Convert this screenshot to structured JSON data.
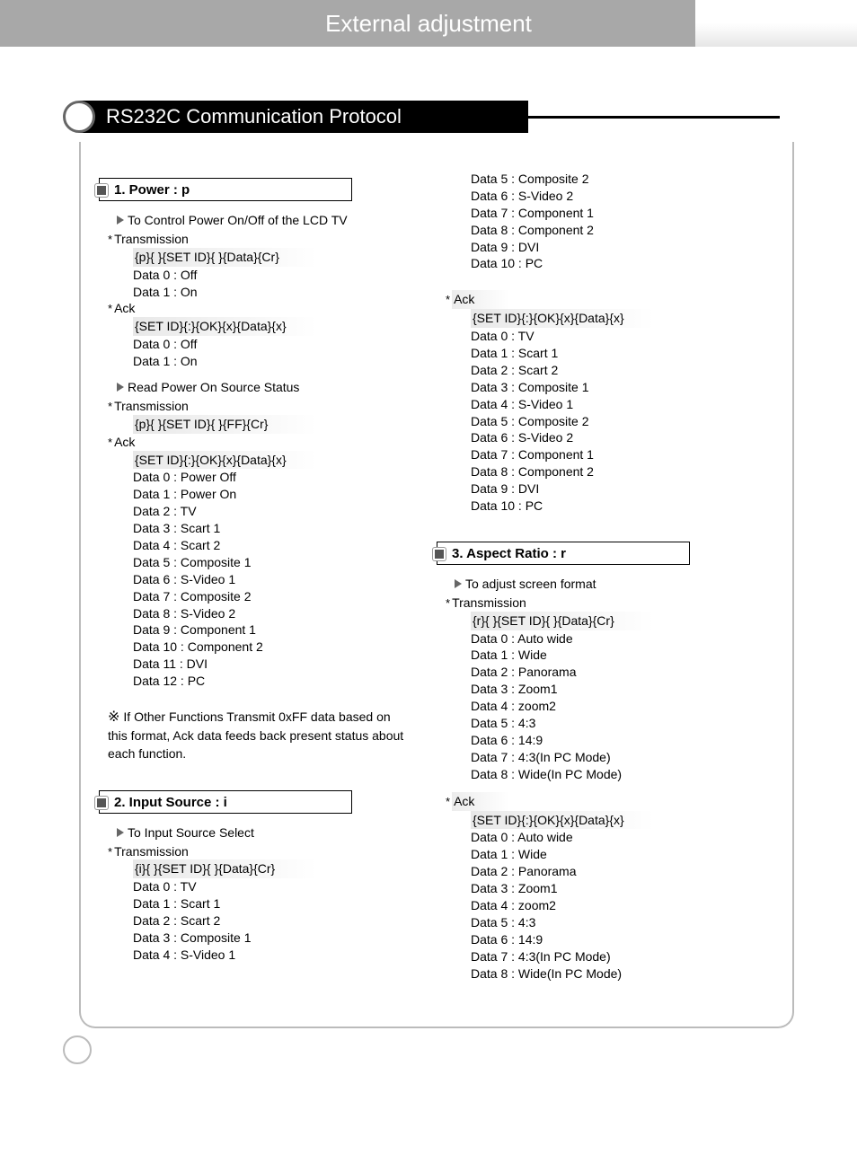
{
  "header": {
    "title": "External adjustment"
  },
  "section": {
    "title": "RS232C Communication Protocol"
  },
  "col1": {
    "cmd1": {
      "header": "1. Power : p",
      "desc1": "To Control Power On/Off of the LCD TV",
      "trans_label": "Transmission",
      "trans_code": "{p}{ }{SET ID}{ }{Data}{Cr}",
      "trans_data": [
        "Data 0 : Off",
        "Data 1 : On"
      ],
      "ack_label": "Ack",
      "ack_code": "{SET ID}{:}{OK}{x}{Data}{x}",
      "ack_data": [
        "Data 0 : Off",
        "Data 1 : On"
      ],
      "desc2": "Read Power On Source Status",
      "trans2_label": "Transmission",
      "trans2_code": "{p}{ }{SET ID}{ }{FF}{Cr}",
      "ack2_label": "Ack",
      "ack2_code": "{SET ID}{:}{OK}{x}{Data}{x}",
      "ack2_data": [
        "Data 0 : Power Off",
        "Data 1 : Power On",
        "Data 2 : TV",
        "Data 3 : Scart 1",
        "Data 4 : Scart 2",
        "Data 5 : Composite 1",
        "Data 6 : S-Video 1",
        "Data 7 : Composite 2",
        "Data 8 : S-Video 2",
        "Data 9 : Component 1",
        "Data 10 : Component 2",
        "Data 11 : DVI",
        "Data 12 : PC"
      ],
      "footnote": "If Other Functions Transmit 0xFF data based on this format, Ack data feeds back present status about each function."
    },
    "cmd2": {
      "header": "2. Input Source : i",
      "desc": "To Input Source Select",
      "trans_label": "Transmission",
      "trans_code": "{i}{ }{SET ID}{ }{Data}{Cr}",
      "trans_data_part1": [
        "Data 0 : TV",
        "Data 1 : Scart 1",
        "Data 2 : Scart 2",
        "Data 3 : Composite 1",
        "Data 4 : S-Video 1"
      ]
    }
  },
  "col2": {
    "cmd2_cont": {
      "trans_data_part2": [
        "Data 5 : Composite 2",
        "Data 6 : S-Video 2",
        "Data 7 : Component 1",
        "Data 8 : Component 2",
        "Data 9 : DVI",
        "Data 10 : PC"
      ],
      "ack_label": "Ack",
      "ack_code": "{SET ID}{:}{OK}{x}{Data}{x}",
      "ack_data": [
        "Data 0 : TV",
        "Data 1 : Scart 1",
        "Data 2 : Scart 2",
        "Data 3 : Composite 1",
        "Data 4 : S-Video 1",
        "Data 5 : Composite 2",
        "Data 6 : S-Video 2",
        "Data 7 : Component 1",
        "Data 8 : Component 2",
        "Data 9 : DVI",
        "Data 10 : PC"
      ]
    },
    "cmd3": {
      "header": "3. Aspect Ratio : r",
      "desc": "To adjust screen format",
      "trans_label": "Transmission",
      "trans_code": "{r}{ }{SET ID}{ }{Data}{Cr}",
      "trans_data": [
        "Data 0 : Auto wide",
        "Data 1 : Wide",
        "Data 2 : Panorama",
        "Data 3 : Zoom1",
        "Data 4 : zoom2",
        "Data 5 : 4:3",
        "Data 6 : 14:9",
        "Data 7 : 4:3(In PC Mode)",
        "Data 8 : Wide(In PC Mode)"
      ],
      "ack_label": "Ack",
      "ack_code": "{SET ID}{:}{OK}{x}{Data}{x}",
      "ack_data": [
        "Data 0 : Auto wide",
        "Data 1 : Wide",
        "Data 2 : Panorama",
        "Data 3 : Zoom1",
        "Data 4 : zoom2",
        "Data 5 : 4:3",
        "Data 6 : 14:9",
        "Data 7 : 4:3(In PC Mode)",
        "Data 8 : Wide(In PC Mode)"
      ]
    }
  }
}
